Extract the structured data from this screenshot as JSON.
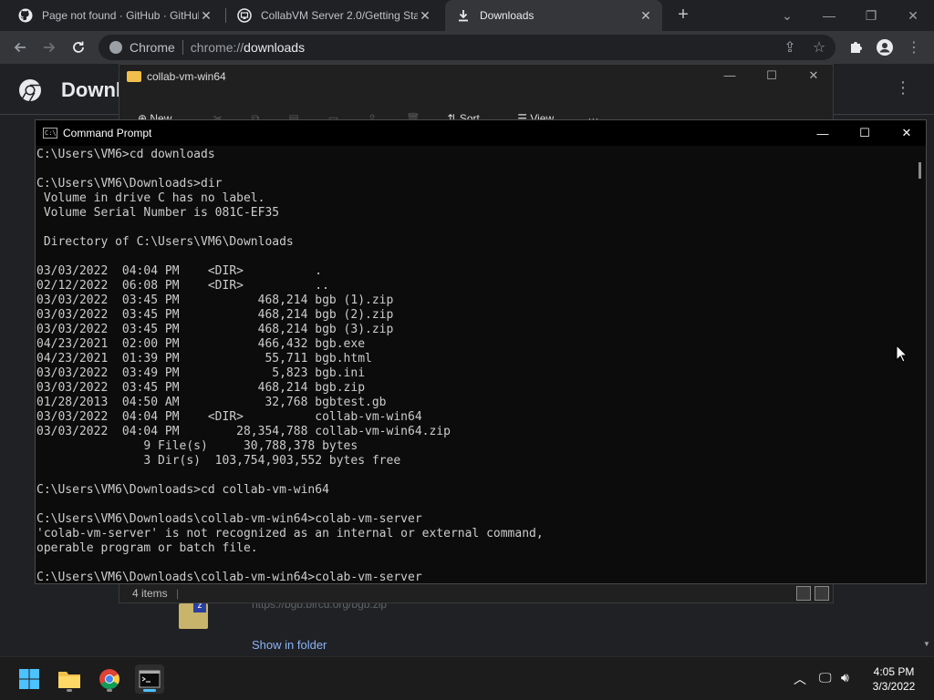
{
  "browser": {
    "tabs": [
      {
        "title": "Page not found · GitHub · GitHub",
        "icon": "github-icon",
        "active": false
      },
      {
        "title": "CollabVM Server 2.0/Getting Sta",
        "icon": "collabvm-icon",
        "active": false
      },
      {
        "title": "Downloads",
        "icon": "download-icon",
        "active": true
      }
    ],
    "omnibox": {
      "site": "Chrome",
      "url_scheme": "chrome://",
      "url_path": "downloads"
    }
  },
  "downloads_page": {
    "title": "Downl",
    "file_url": "https://bgb.bircd.org/bgb.zip",
    "show_in_folder": "Show in folder"
  },
  "explorer": {
    "title": "collab-vm-win64",
    "toolbar": {
      "new": "New",
      "sort": "Sort",
      "view": "View",
      "more": "···"
    },
    "status": "4 items"
  },
  "cmd": {
    "title": "Command Prompt",
    "lines": [
      "C:\\Users\\VM6>cd downloads",
      "",
      "C:\\Users\\VM6\\Downloads>dir",
      " Volume in drive C has no label.",
      " Volume Serial Number is 081C-EF35",
      "",
      " Directory of C:\\Users\\VM6\\Downloads",
      "",
      "03/03/2022  04:04 PM    <DIR>          .",
      "02/12/2022  06:08 PM    <DIR>          ..",
      "03/03/2022  03:45 PM           468,214 bgb (1).zip",
      "03/03/2022  03:45 PM           468,214 bgb (2).zip",
      "03/03/2022  03:45 PM           468,214 bgb (3).zip",
      "04/23/2021  02:00 PM           466,432 bgb.exe",
      "04/23/2021  01:39 PM            55,711 bgb.html",
      "03/03/2022  03:49 PM             5,823 bgb.ini",
      "03/03/2022  03:45 PM           468,214 bgb.zip",
      "01/28/2013  04:50 AM            32,768 bgbtest.gb",
      "03/03/2022  04:04 PM    <DIR>          collab-vm-win64",
      "03/03/2022  04:04 PM        28,354,788 collab-vm-win64.zip",
      "               9 File(s)     30,788,378 bytes",
      "               3 Dir(s)  103,754,903,552 bytes free",
      "",
      "C:\\Users\\VM6\\Downloads>cd collab-vm-win64",
      "",
      "C:\\Users\\VM6\\Downloads\\collab-vm-win64>colab-vm-server",
      "'colab-vm-server' is not recognized as an internal or external command,",
      "operable program or batch file.",
      "",
      "C:\\Users\\VM6\\Downloads\\collab-vm-win64>colab-vm-server"
    ]
  },
  "taskbar": {
    "time": "4:05 PM",
    "date": "3/3/2022"
  }
}
